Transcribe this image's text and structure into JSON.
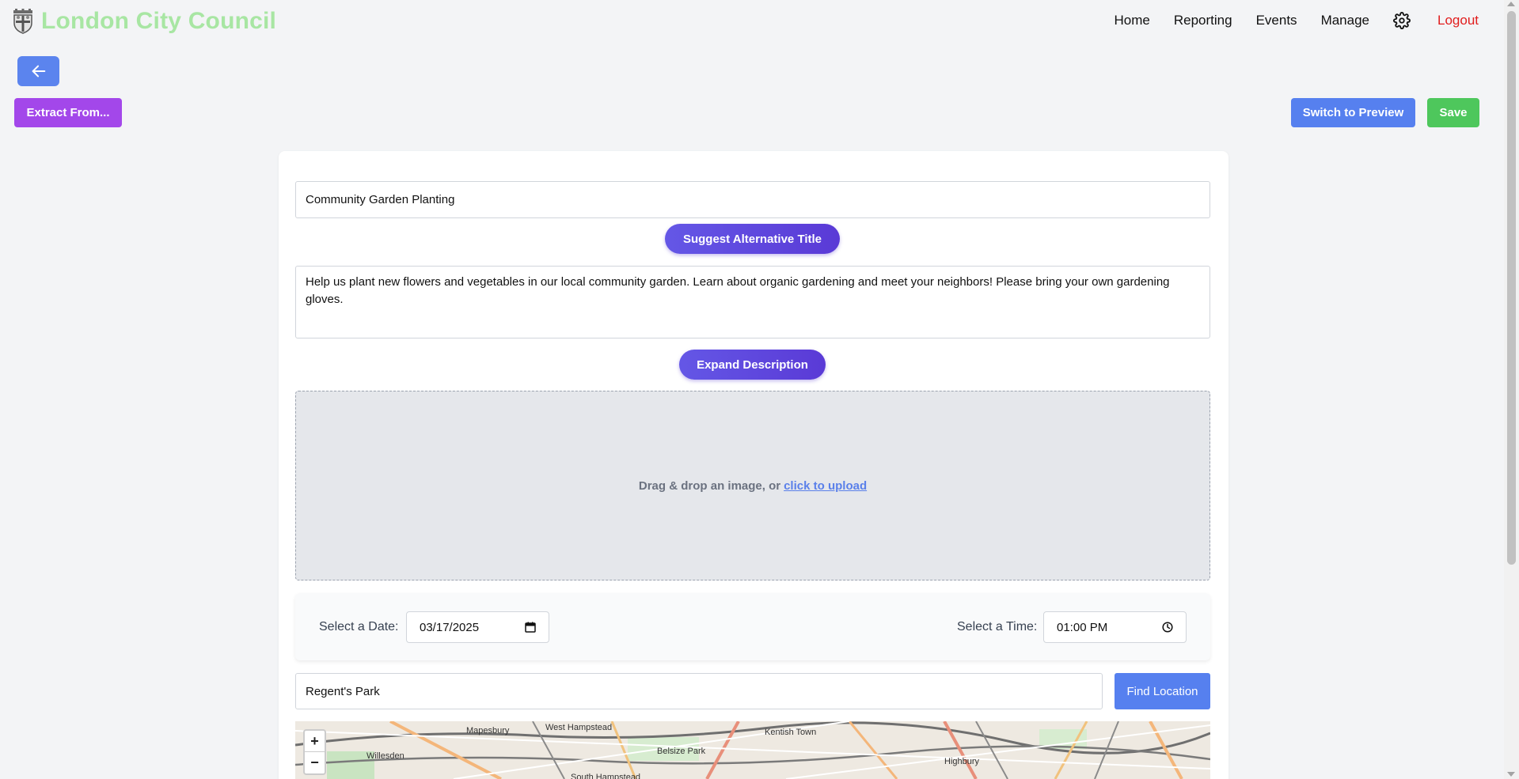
{
  "header": {
    "title": "London City Council",
    "nav": [
      "Home",
      "Reporting",
      "Events",
      "Manage"
    ],
    "logout": "Logout"
  },
  "toolbar": {
    "extract_label": "Extract From...",
    "preview_label": "Switch to Preview",
    "save_label": "Save"
  },
  "form": {
    "title_value": "Community Garden Planting",
    "suggest_label": "Suggest Alternative Title",
    "description_value": "Help us plant new flowers and vegetables in our local community garden. Learn about organic gardening and meet your neighbors! Please bring your own gardening gloves.",
    "expand_label": "Expand Description",
    "dropzone_text": "Drag & drop an image, or",
    "upload_link": "click to upload",
    "date_label": "Select a Date:",
    "date_value": "03/17/2025",
    "time_label": "Select a Time:",
    "time_value": "01:00 PM",
    "location_value": "Regent's Park",
    "find_label": "Find Location"
  },
  "map": {
    "labels": [
      "Mapesbury",
      "West Hampstead",
      "Kentish Town",
      "Willesden",
      "Belsize Park",
      "Highbury",
      "South Hampstead"
    ],
    "zoom_in": "+",
    "zoom_out": "−"
  },
  "colors": {
    "brand": "#a8e6a3",
    "primary": "#5680ef",
    "purple": "#a347ea",
    "save": "#4ec75c",
    "logout": "#e11d1d"
  },
  "icons": {
    "back": "arrow-left-icon",
    "settings": "gear-icon",
    "crest": "crest-icon",
    "calendar": "calendar-icon",
    "clock": "clock-icon"
  }
}
